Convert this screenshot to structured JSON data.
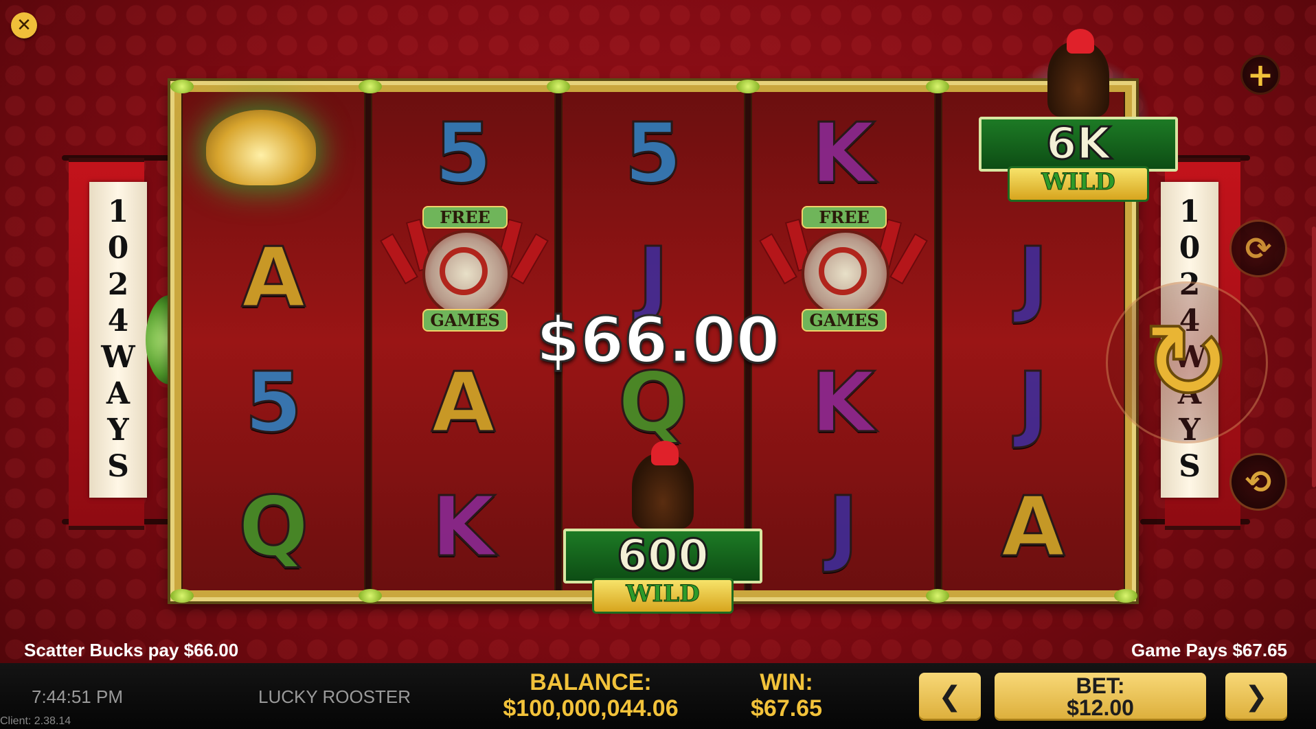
{
  "reels": {
    "ways_text": "1024WAYS",
    "columns": [
      {
        "symbols": [
          {
            "glyph": "",
            "color": "gold"
          },
          {
            "glyph": "A",
            "color": "gold"
          },
          {
            "glyph": "5",
            "color": "blue"
          },
          {
            "glyph": "Q",
            "color": "green"
          }
        ]
      },
      {
        "symbols": [
          {
            "glyph": "5",
            "color": "blue"
          },
          {
            "glyph": "",
            "color": ""
          },
          {
            "glyph": "A",
            "color": "gold"
          },
          {
            "glyph": "K",
            "color": "purple"
          }
        ]
      },
      {
        "symbols": [
          {
            "glyph": "5",
            "color": "blue"
          },
          {
            "glyph": "J",
            "color": "indigo"
          },
          {
            "glyph": "Q",
            "color": "green"
          },
          {
            "glyph": "",
            "color": ""
          }
        ]
      },
      {
        "symbols": [
          {
            "glyph": "K",
            "color": "purple"
          },
          {
            "glyph": "",
            "color": ""
          },
          {
            "glyph": "K",
            "color": "purple"
          },
          {
            "glyph": "J",
            "color": "indigo"
          }
        ]
      },
      {
        "symbols": [
          {
            "glyph": "",
            "color": ""
          },
          {
            "glyph": "J",
            "color": "indigo"
          },
          {
            "glyph": "J",
            "color": "indigo"
          },
          {
            "glyph": "A",
            "color": "gold"
          }
        ]
      }
    ],
    "scatter": {
      "top": "FREE",
      "bottom": "GAMES"
    },
    "wild_top": {
      "multiplier": "6K",
      "label": "WILD"
    },
    "wild_bottom": {
      "multiplier": "600",
      "label": "WILD"
    },
    "win_amount": "$66.00"
  },
  "messages": {
    "left": "Scatter Bucks pay $66.00",
    "right": "Game Pays $67.65"
  },
  "footer": {
    "time": "7:44:51 PM",
    "game_name": "LUCKY ROOSTER",
    "client": "Client: 2.38.14",
    "balance_label": "BALANCE:",
    "balance_value": "$100,000,044.06",
    "win_label": "WIN:",
    "win_value": "$67.65",
    "bet_label": "BET:",
    "bet_value": "$12.00",
    "prev_glyph": "❮",
    "next_glyph": "❯"
  },
  "controls": {
    "close_glyph": "✕",
    "plus_glyph": "+",
    "auto_glyph": "⟳",
    "spin_glyph": "↻",
    "refresh_glyph": "⟲"
  },
  "colors": {
    "accent_gold": "#f2c23a",
    "background_red": "#8f0b12",
    "bar_black": "#0a0a0a"
  }
}
